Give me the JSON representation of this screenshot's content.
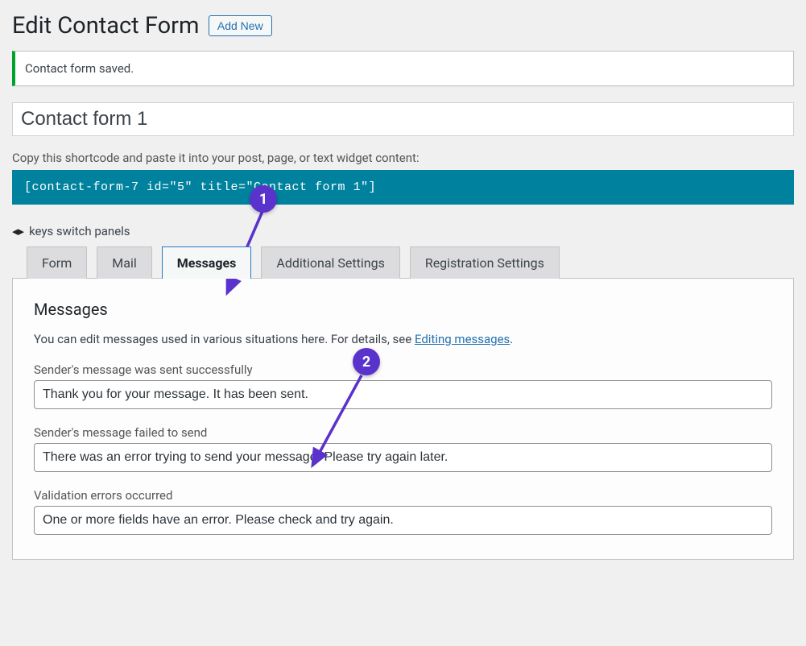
{
  "header": {
    "title": "Edit Contact Form",
    "add_new_label": "Add New"
  },
  "notice": {
    "text": "Contact form saved."
  },
  "form_name": "Contact form 1",
  "shortcode": {
    "label": "Copy this shortcode and paste it into your post, page, or text widget content:",
    "value": "[contact-form-7 id=\"5\" title=\"Contact form 1\"]"
  },
  "keys_hint": {
    "glyph": "◂▸",
    "text": "keys switch panels"
  },
  "tabs": [
    "Form",
    "Mail",
    "Messages",
    "Additional Settings",
    "Registration Settings"
  ],
  "active_tab_index": 2,
  "messages_panel": {
    "heading": "Messages",
    "desc_pre": "You can edit messages used in various situations here. For details, see ",
    "desc_link": "Editing messages",
    "desc_post": ".",
    "groups": [
      {
        "label": "Sender's message was sent successfully",
        "value": "Thank you for your message. It has been sent."
      },
      {
        "label": "Sender's message failed to send",
        "value": "There was an error trying to send your message. Please try again later."
      },
      {
        "label": "Validation errors occurred",
        "value": "One or more fields have an error. Please check and try again."
      }
    ]
  },
  "annotations": {
    "badge1": "1",
    "badge2": "2"
  }
}
